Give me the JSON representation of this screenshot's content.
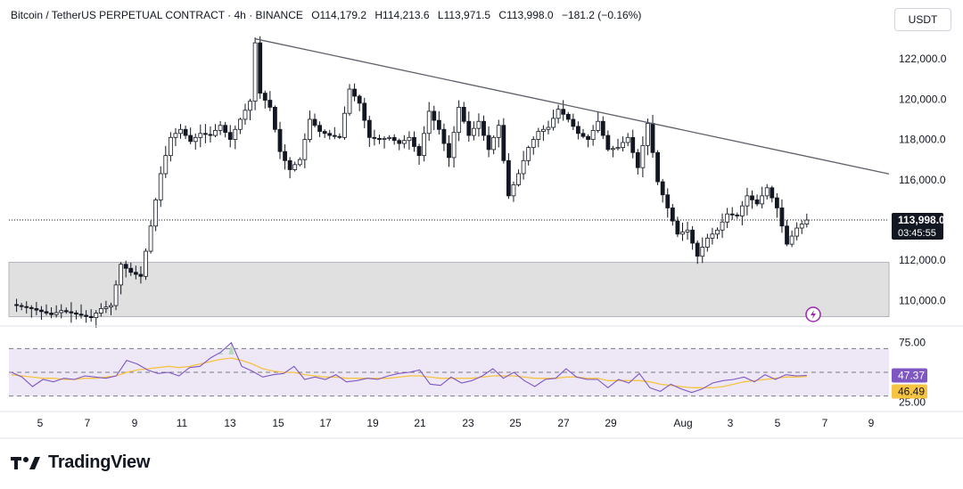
{
  "header": {
    "symbol": "Bitcoin / TetherUS PERPETUAL CONTRACT · 4h · BINANCE",
    "open": "O114,179.2",
    "high": "H114,213.6",
    "low": "L113,971.5",
    "close": "C113,998.0",
    "change": "−181.2 (−0.16%)"
  },
  "currency_button": "USDT",
  "colors": {
    "up": "#131722",
    "down": "#131722",
    "trendline": "#5d606b",
    "zone": "#e0e0e0",
    "rsi_line": "#7e57c2",
    "rsi_ma": "#f6c343",
    "rsi_band": "#ede7f6",
    "price_tag_bg": "#131722",
    "rsi_tag_bg": "#7e57c2",
    "ma_tag_bg": "#f6c343",
    "bolt": "#9c27b0"
  },
  "last_price": "113,998.0",
  "countdown": "03:45:55",
  "rsi_value": "47.37",
  "rsi_ma_value": "46.49",
  "x_ticks": [
    "5",
    "7",
    "9",
    "11",
    "13",
    "15",
    "17",
    "19",
    "21",
    "23",
    "25",
    "27",
    "29",
    "Aug",
    "3",
    "5",
    "7",
    "9"
  ],
  "logo_text": "TradingView",
  "bolt_icon": "lightning-icon",
  "chart_data": {
    "type": "candlestick",
    "title": "Bitcoin / TetherUS PERPETUAL CONTRACT · 4h · BINANCE",
    "y_ticks": [
      "122,000.0",
      "120,000.0",
      "118,000.0",
      "116,000.0",
      "112,000.0",
      "110,000.0"
    ],
    "y_tick_values": [
      122000,
      120000,
      118000,
      116000,
      112000,
      110000
    ],
    "ylim": [
      109000,
      123600
    ],
    "price_series": [
      [
        0,
        109800
      ],
      [
        2,
        109600
      ],
      [
        4,
        109300
      ],
      [
        5,
        109500
      ],
      [
        8,
        109150
      ],
      [
        9,
        109600
      ],
      [
        10,
        109750
      ],
      [
        11,
        111800
      ],
      [
        12,
        111400
      ],
      [
        13,
        111200
      ],
      [
        14,
        113700
      ],
      [
        15,
        116300
      ],
      [
        16,
        118100
      ],
      [
        17,
        118500
      ],
      [
        18,
        117900
      ],
      [
        19,
        118300
      ],
      [
        20,
        118200
      ],
      [
        21,
        118700
      ],
      [
        22,
        118000
      ],
      [
        23,
        119000
      ],
      [
        24,
        119900
      ],
      [
        24.5,
        122800
      ],
      [
        25,
        120300
      ],
      [
        26,
        119600
      ],
      [
        27,
        117400
      ],
      [
        28,
        116500
      ],
      [
        29,
        117000
      ],
      [
        30,
        119000
      ],
      [
        31,
        118400
      ],
      [
        32,
        118200
      ],
      [
        33,
        118100
      ],
      [
        34,
        120500
      ],
      [
        35,
        119800
      ],
      [
        36,
        118100
      ],
      [
        37,
        118000
      ],
      [
        38,
        118100
      ],
      [
        39,
        117800
      ],
      [
        40,
        118100
      ],
      [
        41,
        117200
      ],
      [
        42,
        119400
      ],
      [
        43,
        118500
      ],
      [
        44,
        117100
      ],
      [
        45,
        119600
      ],
      [
        46,
        118200
      ],
      [
        47,
        118900
      ],
      [
        48,
        117500
      ],
      [
        49,
        118700
      ],
      [
        50,
        115200
      ],
      [
        51,
        116300
      ],
      [
        52,
        117600
      ],
      [
        53,
        118400
      ],
      [
        54,
        118600
      ],
      [
        55,
        119500
      ],
      [
        56,
        119000
      ],
      [
        57,
        118300
      ],
      [
        58,
        118000
      ],
      [
        59,
        118900
      ],
      [
        60,
        117500
      ],
      [
        61,
        117600
      ],
      [
        62,
        118100
      ],
      [
        63,
        116600
      ],
      [
        64,
        118800
      ],
      [
        65,
        115900
      ],
      [
        66,
        114600
      ],
      [
        67,
        113300
      ],
      [
        68,
        113500
      ],
      [
        69,
        112200
      ],
      [
        70,
        113100
      ],
      [
        71,
        113500
      ],
      [
        72,
        114300
      ],
      [
        73,
        114200
      ],
      [
        74,
        115200
      ],
      [
        75,
        114800
      ],
      [
        76,
        115600
      ],
      [
        77,
        114600
      ],
      [
        78,
        112800
      ],
      [
        79,
        113600
      ],
      [
        80,
        113998
      ]
    ],
    "period_open": 114179.2,
    "period_high": 114213.6,
    "period_low": 113971.5,
    "period_close": 113998.0,
    "trendline": [
      [
        24.5,
        123000
      ],
      [
        86,
        116500
      ]
    ],
    "support_zone": [
      109200,
      111900
    ],
    "rsi": {
      "y_ticks": [
        "75.00",
        "25.00"
      ],
      "levels": [
        70,
        50,
        30
      ],
      "values": [
        50,
        46,
        38,
        44,
        42,
        45,
        44,
        47,
        46,
        45,
        47,
        60,
        57,
        52,
        49,
        50,
        47,
        54,
        55,
        62,
        67,
        75,
        55,
        51,
        46,
        48,
        49,
        55,
        44,
        46,
        44,
        48,
        42,
        43,
        45,
        44,
        47,
        49,
        50,
        52,
        40,
        39,
        46,
        41,
        43,
        47,
        53,
        45,
        50,
        43,
        38,
        44,
        45,
        53,
        46,
        44,
        44,
        37,
        44,
        41,
        49,
        37,
        34,
        40,
        36,
        33,
        36,
        41,
        43,
        44,
        46,
        42,
        48,
        44,
        48,
        47,
        47.37
      ],
      "ma_values": [
        48,
        47,
        46,
        45,
        45,
        44,
        44,
        45,
        45,
        46,
        47,
        50,
        52,
        53,
        54,
        55,
        54,
        55,
        57,
        59,
        61,
        62,
        60,
        57,
        53,
        51,
        50,
        50,
        48,
        47,
        46,
        46,
        45,
        45,
        45,
        45,
        45,
        46,
        47,
        47,
        46,
        45,
        45,
        45,
        45,
        46,
        47,
        47,
        47,
        46,
        45,
        45,
        45,
        46,
        46,
        45,
        45,
        43,
        43,
        43,
        43,
        42,
        40,
        39,
        38,
        37,
        37,
        37,
        38,
        40,
        42,
        43,
        44,
        45,
        46,
        46,
        46.49
      ]
    }
  }
}
